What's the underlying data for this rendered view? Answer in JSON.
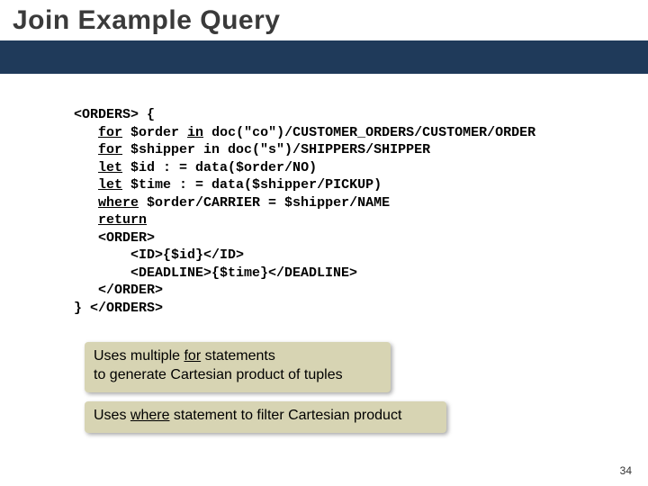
{
  "title": "Join Example Query",
  "code": {
    "l1a": "<ORDERS> {",
    "l2_kw": "for",
    "l2_mid": " $order ",
    "l2_kw2": "in",
    "l2_rest": " doc(\"co\")/CUSTOMER_ORDERS/CUSTOMER/ORDER",
    "l3_kw": "for",
    "l3_rest": " $shipper in doc(\"s\")/SHIPPERS/SHIPPER",
    "l4_kw": "let",
    "l4_rest": " $id : = data($order/NO)",
    "l5_kw": "let",
    "l5_rest": " $time : = data($shipper/PICKUP)",
    "l6_kw": "where",
    "l6_rest": " $order/CARRIER = $shipper/NAME",
    "l7_kw": "return",
    "l8": "<ORDER>",
    "l9": "<ID>{$id}</ID>",
    "l10": "<DEADLINE>{$time}</DEADLINE>",
    "l11": "</ORDER>",
    "l12": "} </ORDERS>"
  },
  "note1": {
    "part1": "Uses multiple ",
    "u": "for",
    "part2": " statements",
    "line2": "to generate Cartesian product of tuples"
  },
  "note2": {
    "part1": "Uses ",
    "u": "where",
    "part2": " statement to filter Cartesian product"
  },
  "page_number": "34"
}
